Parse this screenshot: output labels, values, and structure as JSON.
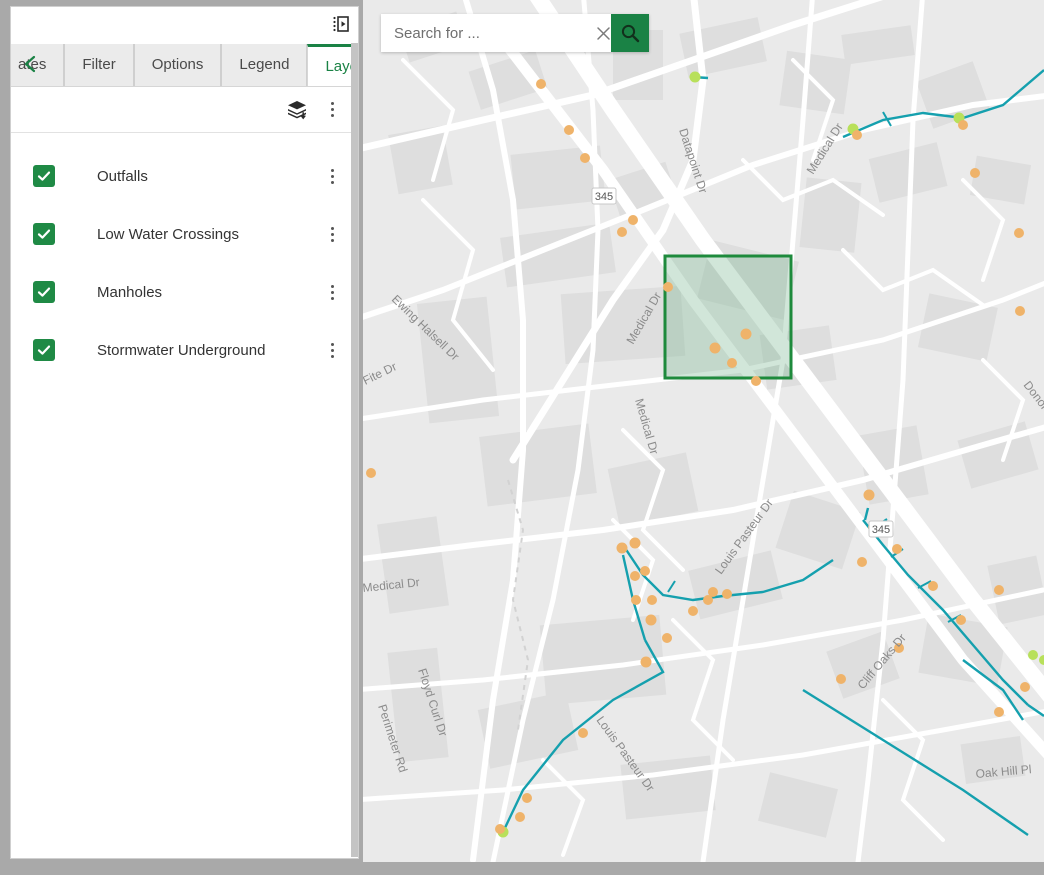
{
  "panel": {
    "collapse_icon": "collapse-panel-icon",
    "scroll_left_icon": "chevron-left-icon",
    "tabs": [
      {
        "label": "ates",
        "active": false,
        "clipped": true
      },
      {
        "label": "Filter",
        "active": false
      },
      {
        "label": "Options",
        "active": false
      },
      {
        "label": "Legend",
        "active": false
      },
      {
        "label": "Layers",
        "active": true
      }
    ],
    "toolbar": {
      "add_layer_icon": "layers-stack-add-icon",
      "more_icon": "more-vertical-icon"
    },
    "layers": [
      {
        "label": "Outfalls",
        "checked": true
      },
      {
        "label": "Low Water Crossings",
        "checked": true
      },
      {
        "label": "Manholes",
        "checked": true
      },
      {
        "label": "Stormwater Underground",
        "checked": true
      }
    ]
  },
  "map": {
    "search": {
      "placeholder": "Search for ...",
      "value": "",
      "clear_icon": "close-icon",
      "submit_icon": "search-icon"
    },
    "selection_box": {
      "label": "selection-rectangle",
      "stroke": "#1e8a3c",
      "fill": "rgba(120,180,140,0.32)"
    },
    "colors": {
      "manhole": "#efb36a",
      "outfall": "#b8e05a",
      "pipe": "#15a0ae",
      "road": "#ffffff",
      "basemap": "#eaeaea",
      "building": "#dedede",
      "accent_green": "#1a8245"
    },
    "street_labels": [
      "Datapoint Dr",
      "Medical Dr",
      "Ewing Halsell Dr",
      "E Fite Dr",
      "Medical Dr",
      "Medical Dr",
      "Medical Dr",
      "Louis Pasteur Dr",
      "Louis Pasteur Dr",
      "Cliff Oaks Dr",
      "Floyd Curl Dr",
      "Perimeter Rd",
      "Oak Hill Pl",
      "Donor"
    ],
    "highway_shields": [
      "345",
      "345"
    ]
  }
}
